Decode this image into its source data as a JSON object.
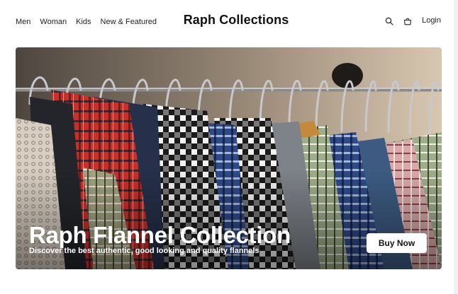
{
  "nav": {
    "links": [
      "Men",
      "Woman",
      "Kids",
      "New & Featured"
    ],
    "brand": "Raph Collections",
    "login": "Login",
    "icons": [
      "search-icon",
      "bag-icon"
    ]
  },
  "hero": {
    "title": "Raph Flannel Collection",
    "subtitle": "Discover the best authentic, good looking and quality flannels",
    "cta": "Buy Now",
    "image": "photo of plaid flannel shirts hanging on a clothing rack"
  }
}
